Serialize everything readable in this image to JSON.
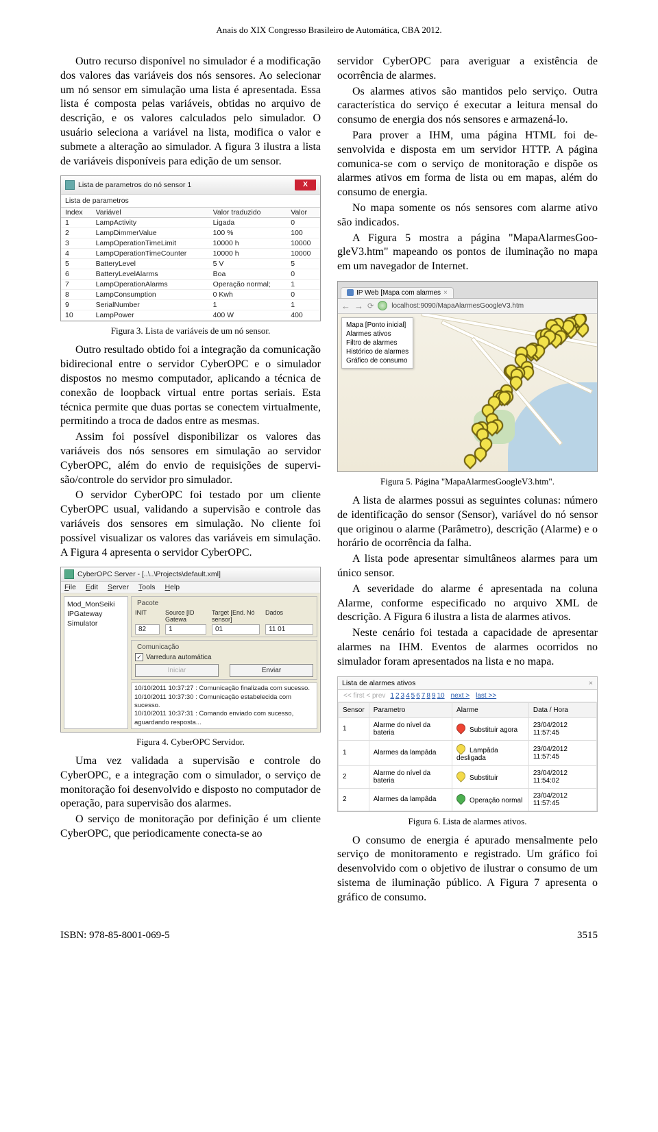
{
  "header": "Anais do XIX Congresso Brasileiro de Automática, CBA 2012.",
  "left": {
    "p1": "Outro recurso disponível no simulador é a modi­ficação dos valores das variáveis dos nós sensores. Ao selecionar um nó sensor em simulação uma lista é apresentada. Essa lista é composta pelas variáveis, obtidas no arquivo de descrição, e os valores calcula­dos pelo simulador. O usuário seleciona a variável na lista, modifica o valor e submete a alteração ao simulador. A figura 3 ilustra a lista de variáveis disponíveis para edição de um sensor.",
    "cap3": "Figura 3. Lista de variáveis de um nó sensor.",
    "p2": "Outro resultado obtido foi a integração da comu­nicação bidirecional entre o servidor CyberOPC e o simulador dispostos no mesmo computador, aplican­do a técnica de conexão de loopback virtual entre portas seriais. Esta técnica permite que duas portas se conectem virtualmente, permitindo a troca de dados entre as mesmas.",
    "p3": "Assim foi possível disponibilizar os valores das variáveis dos nós sensores em simulação ao servidor CyberOPC, além do envio de requisições de supervi­são/controle do servidor pro simulador.",
    "p4": "O servidor CyberOPC foi testado por um cliente CyberOPC usual, validando a supervisão e controle das variáveis dos sensores em simulação. No cliente foi possível visualizar os valores das variáveis em simulação. A Figura 4 apresenta o servidor Cybe­rOPC.",
    "cap4": "Figura 4. CyberOPC Servidor.",
    "p5": "Uma vez validada a supervisão e controle do CyberOPC, e a integração com o simulador, o serviço de monitoração foi desenvolvido e disposto no com­putador de operação, para supervisão dos alarmes.",
    "p6": "O serviço de monitoração por definição é um cliente CyberOPC, que periodicamente conecta-se ao"
  },
  "right": {
    "p1": "servidor CyberOPC para averiguar a existência de ocorrência de alarmes.",
    "p2": "Os alarmes ativos são mantidos pelo serviço. Ou­tra característica do serviço é executar a leitura men­sal do consumo de energia dos nós sensores e arma­zená-lo.",
    "p3": "Para prover a IHM, uma página HTML foi de­senvolvida e disposta em um servidor HTTP. A pági­na comunica-se com o serviço de monitoração e dis­põe os alarmes ativos em forma de lista ou em mapas, além do consumo de energia.",
    "p4": "No mapa somente os nós sensores com alarme ativo são indicados.",
    "p5": "A Figura 5 mostra a página \"MapaAlarmesGoo­gleV3.htm\" mapeando os pontos de iluminação no mapa em um navegador de Internet.",
    "cap5": "Figura 5. Página \"MapaAlarmesGoogleV3.htm\".",
    "p6": "A lista de alarmes possui as seguintes colunas: número de identificação do sensor (Sensor), variável do nó sensor que originou o alarme (Parâmetro), des­crição (Alarme) e o horário de ocorrência da falha.",
    "p7": "A lista pode apresentar simultâneos alarmes para um único sensor.",
    "p8": "A severidade do alarme é apresentada na coluna Alarme, conforme especificado no arquivo XML de descrição. A Figura 6 ilustra a lista de alarmes ativos.",
    "p9": "Neste cenário foi testada a capacidade de apre­sentar alarmes na IHM. Eventos de alarmes ocorridos no simulador foram apresentados na lista e no mapa.",
    "cap6": "Figura 6. Lista de alarmes ativos.",
    "p10": "O consumo de energia é apurado mensalmente pelo serviço de monitoramento e registrado. Um grá­fico foi desenvolvido com o objetivo de ilustrar o consumo de um sistema de iluminação público. A Figura 7 apresenta o gráfico de consumo."
  },
  "f3": {
    "title": "Lista de parametros do nó sensor 1",
    "close": "X",
    "tab": "Lista de parametros",
    "headers": [
      "Index",
      "Variável",
      "Valor traduzido",
      "Valor"
    ],
    "rows": [
      [
        "1",
        "LampActivity",
        "Ligada",
        "0"
      ],
      [
        "2",
        "LampDimmerValue",
        "100 %",
        "100"
      ],
      [
        "3",
        "LampOperationTimeLimit",
        "10000 h",
        "10000"
      ],
      [
        "4",
        "LampOperationTimeCounter",
        "10000 h",
        "10000"
      ],
      [
        "5",
        "BatteryLevel",
        "5 V",
        "5"
      ],
      [
        "6",
        "BatteryLevelAlarms",
        "Boa",
        "0"
      ],
      [
        "7",
        "LampOperationAlarms",
        "Operação normal;",
        "1"
      ],
      [
        "8",
        "LampConsumption",
        "0 Kwh",
        "0"
      ],
      [
        "9",
        "SerialNumber",
        "1",
        "1"
      ],
      [
        "10",
        "LampPower",
        "400 W",
        "400"
      ]
    ]
  },
  "f4": {
    "title": "CyberOPC Server - [..\\..\\Projects\\default.xml]",
    "menu": [
      "File",
      "Edit",
      "Server",
      "Tools",
      "Help"
    ],
    "side": [
      "Mod_MonSeiki",
      "IPGateway",
      "Simulator"
    ],
    "group_pacote": "Pacote",
    "grid_headers": [
      "INIT",
      "Source [ID Gatewa",
      "Target [End. Nó sensor]",
      "Dados"
    ],
    "grid_row": [
      "82",
      "1",
      "01",
      "11 01"
    ],
    "group_com": "Comunicação",
    "chk_label": "Varredura automática",
    "btn_iniciar": "Iniciar",
    "btn_enviar": "Enviar",
    "log": [
      "10/10/2011 10:37:27 : Comunicação finalizada com sucesso.",
      "10/10/2011 10:37:30 : Comunicação estabelecida com sucesso.",
      "10/10/2011 10:37:31 : Comando enviado com sucesso, aguardando resposta..."
    ]
  },
  "f5": {
    "tab": "IP Web [Mapa com alarmes",
    "url": "localhost:9090/MapaAlarmesGoogleV3.htm",
    "menu": [
      "Mapa [Ponto inicial]",
      "Alarmes ativos",
      "Filtro de alarmes",
      "Histórico de alarmes",
      "Gráfico de consumo"
    ]
  },
  "f6": {
    "title": "Lista de alarmes ativos",
    "pag_muted": "<< first  < prev",
    "pag_nums": [
      "1",
      "2",
      "3",
      "4",
      "5",
      "6",
      "7",
      "8",
      "9",
      "10"
    ],
    "pag_next": "next >",
    "pag_last": "last >>",
    "headers": [
      "Sensor",
      "Parametro",
      "Alarme",
      "Data / Hora"
    ],
    "rows": [
      {
        "sensor": "1",
        "param": "Alarme do nível da bateria",
        "sev": "red",
        "alarme": "Substituir agora",
        "data": "23/04/2012 11:57:45"
      },
      {
        "sensor": "1",
        "param": "Alarmes da lampâda",
        "sev": "yellow",
        "alarme": "Lampâda desligada",
        "data": "23/04/2012 11:57:45"
      },
      {
        "sensor": "2",
        "param": "Alarme do nível da bateria",
        "sev": "yellow",
        "alarme": "Substituir",
        "data": "23/04/2012 11:54:02"
      },
      {
        "sensor": "2",
        "param": "Alarmes da lampâda",
        "sev": "green",
        "alarme": "Operação normal",
        "data": "23/04/2012 11:57:45"
      }
    ]
  },
  "footer": {
    "isbn": "ISBN: 978-85-8001-069-5",
    "page": "3515"
  }
}
